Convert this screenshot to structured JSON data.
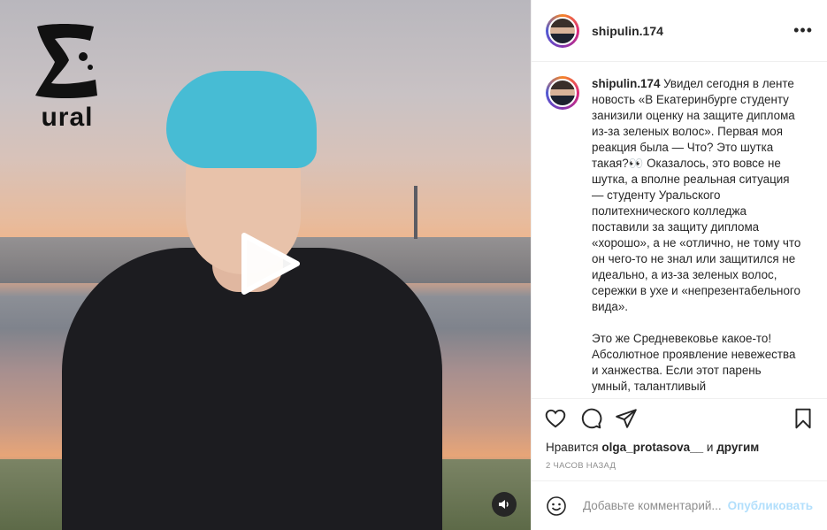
{
  "header": {
    "username": "shipulin.174",
    "more_label": "•••"
  },
  "media": {
    "logo_text": "ural"
  },
  "caption": {
    "username": "shipulin.174",
    "text": " Увидел сегодня в ленте новость «В Екатеринбурге студенту занизили оценку на защите диплома из-за зеленых волос». Первая моя реакция была — Что? Это шутка такая?👀 Оказалось, это вовсе не шутка, а вполне реальная ситуация — студенту Уральского политехнического колледжа поставили за защиту диплома «хорошо», а не «отлично, не тому что он чего-то не знал или защитился не идеально, а из-за зеленых волос, сережки в ухе и «непрезентабельного вида».\n\nЭто же Средневековье какое-то! Абсолютное проявление невежества и ханжества. Если этот парень умный, талантливый"
  },
  "likes": {
    "prefix": "Нравится",
    "user": "olga_protasova__",
    "middle": "и",
    "others": "другим"
  },
  "timestamp": "2 ЧАСОВ НАЗАД",
  "comment": {
    "placeholder": "Добавьте комментарий...",
    "post_label": "Опубликовать"
  },
  "colors": {
    "accent": "#b2dffc",
    "text": "#262626",
    "muted": "#8e8e8e"
  },
  "icons": [
    "heart-icon",
    "comment-icon",
    "share-icon",
    "bookmark-icon",
    "emoji-icon",
    "play-icon",
    "sound-icon",
    "more-icon"
  ]
}
